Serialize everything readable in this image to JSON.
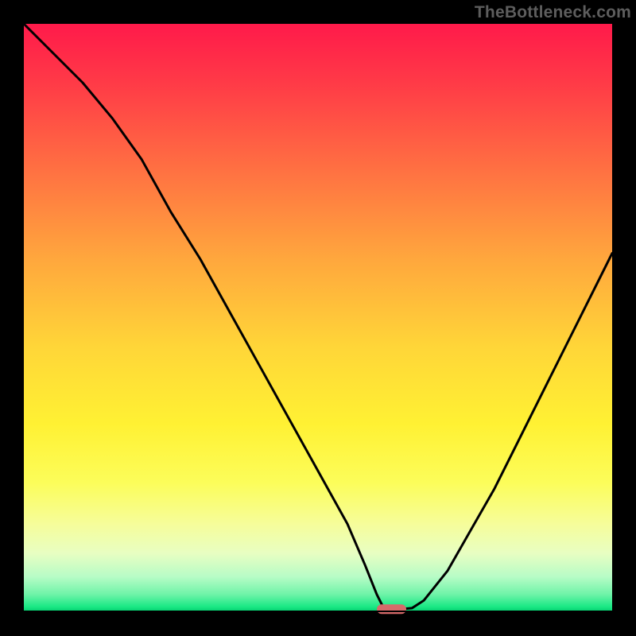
{
  "watermark": "TheBottleneck.com",
  "colors": {
    "gradient_top": "#ff1a4a",
    "gradient_mid": "#ffd638",
    "gradient_bottom": "#00cf6f",
    "curve": "#000000",
    "background": "#000000"
  },
  "chart_data": {
    "type": "line",
    "title": "",
    "xlabel": "",
    "ylabel": "",
    "xlim": [
      0,
      100
    ],
    "ylim": [
      0,
      100
    ],
    "series": [
      {
        "name": "bottleneck-curve",
        "x": [
          0,
          5,
          10,
          15,
          20,
          25,
          30,
          35,
          40,
          45,
          50,
          55,
          58,
          60,
          61,
          62,
          64,
          66,
          68,
          72,
          76,
          80,
          84,
          88,
          92,
          96,
          100
        ],
        "y": [
          100,
          95,
          90,
          84,
          77,
          68,
          60,
          51,
          42,
          33,
          24,
          15,
          8,
          3,
          1,
          0.5,
          0.5,
          0.7,
          2,
          7,
          14,
          21,
          29,
          37,
          45,
          53,
          61
        ]
      }
    ],
    "marker": {
      "name": "optimal-marker",
      "x_range": [
        60,
        65
      ],
      "y": 0.5,
      "color": "#d66a6a"
    }
  }
}
